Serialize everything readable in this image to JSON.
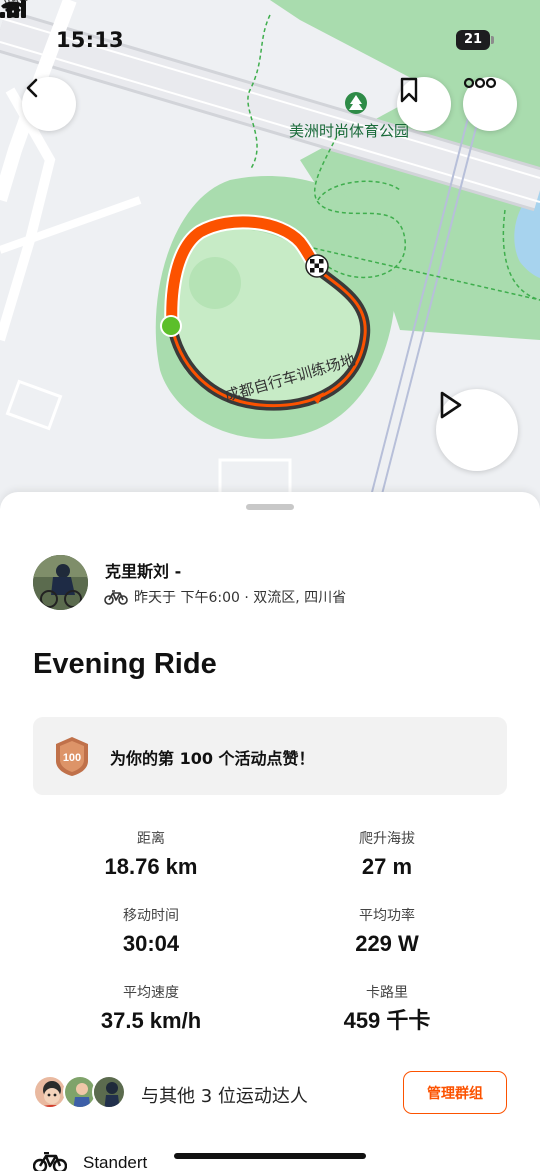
{
  "status_bar": {
    "time": "15:13",
    "battery_level": "21"
  },
  "map": {
    "road_label": "四段",
    "park_label": "美洲时尚体育公园",
    "track_label": "成都自行车训练场地",
    "route_color": "#fc5200",
    "park_color": "#a9dcae"
  },
  "toolbar": {
    "back_icon": "chevron-left-icon",
    "bookmark_icon": "bookmark-icon",
    "more_icon": "more-horizontal-icon",
    "play_icon": "play-icon"
  },
  "athlete": {
    "name": "克里斯刘 -",
    "meta": "昨天于 下午6:00 · 双流区, 四川省"
  },
  "activity": {
    "title": "Evening Ride"
  },
  "banner": {
    "badge_number": "100",
    "text": "为你的第 100 个活动点赞！"
  },
  "stats": {
    "distance": {
      "label": "距离",
      "value": "18.76 km"
    },
    "elevation": {
      "label": "爬升海拔",
      "value": "27 m"
    },
    "moving_time": {
      "label": "移动时间",
      "value": "30:04"
    },
    "avg_power": {
      "label": "平均功率",
      "value": "229 W"
    },
    "avg_speed": {
      "label": "平均速度",
      "value": "37.5 km/h"
    },
    "calories": {
      "label": "卡路里",
      "value": "459 千卡"
    }
  },
  "group": {
    "text": "与其他 3 位运动达人",
    "manage_label": "管理群组"
  },
  "gear": {
    "name": "Standert"
  },
  "colors": {
    "accent": "#fc5200",
    "start_marker": "#5cbf2a"
  }
}
